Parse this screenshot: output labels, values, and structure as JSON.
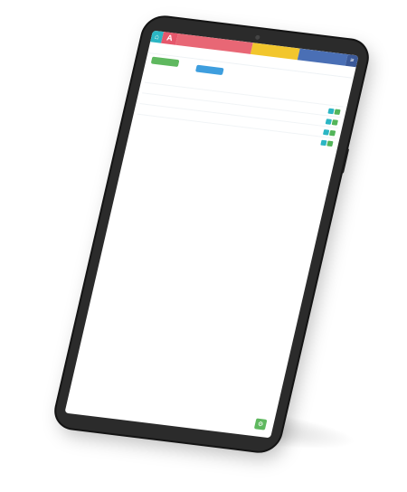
{
  "topbar": {
    "home_icon": "home-icon",
    "logo_icon": "logo-icon",
    "menu_icon": "menu-icon",
    "colors": {
      "teal": "#2bb6c4",
      "red": "#e86775",
      "yellow": "#f2c62d",
      "blue": "#4a6fb5"
    }
  },
  "fab": {
    "icon": "settings-icon",
    "color": "#5fb85f"
  }
}
